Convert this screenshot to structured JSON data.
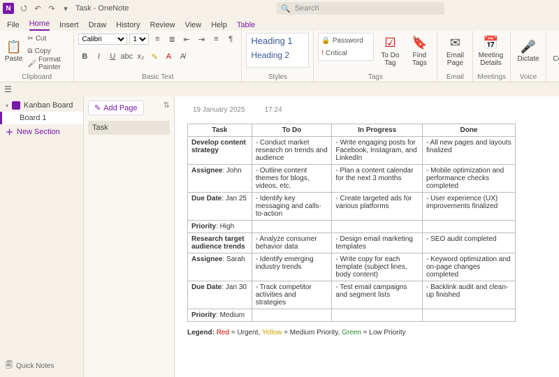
{
  "titlebar": {
    "title": "Task - OneNote",
    "search_placeholder": "Search"
  },
  "menu": {
    "tabs": [
      "File",
      "Home",
      "Insert",
      "Draw",
      "History",
      "Review",
      "View",
      "Help",
      "Table"
    ],
    "active": "Home"
  },
  "ribbon": {
    "clipboard": {
      "paste": "Paste",
      "cut": "Cut",
      "copy": "Copy",
      "format_painter": "Format Painter",
      "label": "Clipboard"
    },
    "basic_text": {
      "font": "Calibri",
      "size": "11",
      "label": "Basic Text"
    },
    "styles": {
      "h1": "Heading 1",
      "h2": "Heading 2",
      "label": "Styles"
    },
    "tags": {
      "password": "Password",
      "critical": "Critical",
      "todo": "To Do Tag",
      "find": "Find Tags",
      "label": "Tags"
    },
    "email": {
      "btn": "Email Page",
      "label": "Email"
    },
    "meetings": {
      "btn": "Meeting Details",
      "label": "Meetings"
    },
    "voice": {
      "btn": "Dictate",
      "label": "Voice"
    },
    "copilot": {
      "btn": "Copilot"
    }
  },
  "nav1": {
    "notebook": "Kanban Board",
    "section": "Board 1",
    "new_section": "New Section",
    "quick": "Quick Notes"
  },
  "nav2": {
    "add_page": "Add Page",
    "page": "Task"
  },
  "page": {
    "date": "19 January 2025",
    "time": "17:24",
    "headers": [
      "Task",
      "To Do",
      "In Progress",
      "Done"
    ],
    "rows": [
      [
        "<b>Develop content strategy</b>",
        "- Conduct market research on trends and audience",
        "- Write engaging posts for Facebook, Instagram, and LinkedIn",
        "- All new pages and layouts finalized"
      ],
      [
        "<b>Assignee</b>: John",
        "- Outline content themes for blogs, videos, etc.",
        "- Plan a content calendar for the next 3 months",
        "- Mobile optimization and performance checks completed"
      ],
      [
        "<b>Due Date</b>: Jan 25",
        "- Identify key messaging and calls-to-action",
        "- Create targeted ads for various platforms",
        "- User experience (UX) improvements finalized"
      ],
      [
        "<b>Priority</b>: High",
        "",
        "",
        ""
      ],
      [
        "<b>Research target audience trends</b>",
        "- Analyze consumer behavior data",
        "- Design email marketing templates",
        "- SEO audit completed"
      ],
      [
        "<b>Assignee</b>: Sarah",
        "- Identify emerging industry trends",
        "- Write copy for each template (subject lines, body content)",
        "- Keyword optimization and on-page changes completed"
      ],
      [
        "<b>Due Date</b>: Jan 30",
        "- Track competitor activities and strategies",
        "- Test email campaigns and segment lists",
        "- Backlink audit and clean-up finished"
      ],
      [
        "<b>Priority</b>: Medium",
        "",
        "",
        ""
      ]
    ],
    "legend_label": "Legend",
    "legend_parts": {
      "red": "Red",
      "urgent": " = Urgent, ",
      "yellow": "Yellow",
      "medium": " = Medium Priority, ",
      "green": "Green",
      "low": " = Low Priority"
    }
  }
}
